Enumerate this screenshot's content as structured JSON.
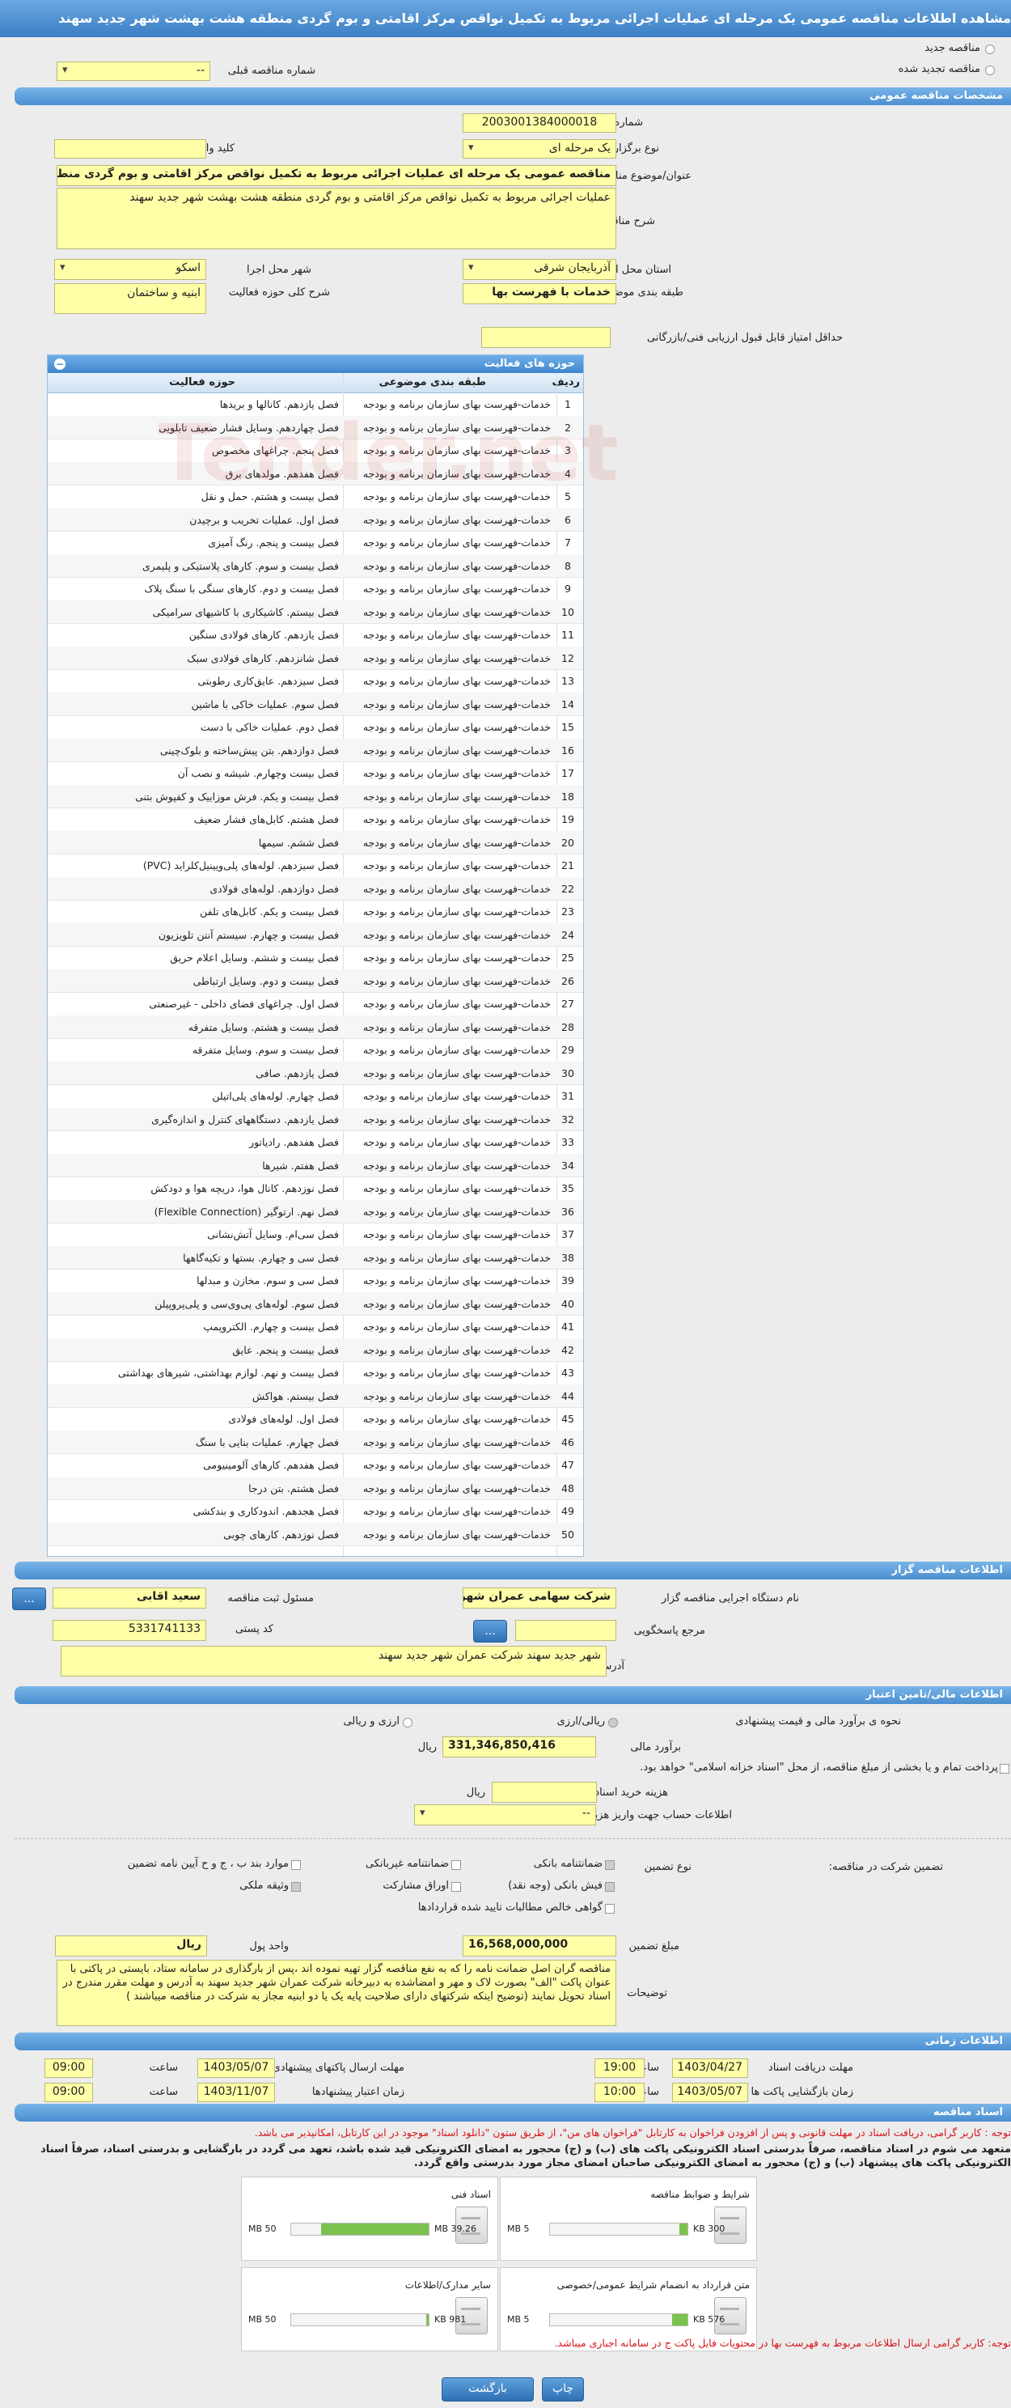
{
  "title": "مشاهده اطلاعات مناقصه عمومی یک مرحله ای عملیات اجرائی مربوط به تکمیل نواقص مرکز اقامتی و بوم گردی منطقه هشت بهشت شهر جدید سهند",
  "top": {
    "new_tender": "مناقصه جدید",
    "renewed_tender": "مناقصه تجدید شده",
    "prev_tender_label": "شماره مناقصه قبلی",
    "prev_tender_value": "--"
  },
  "sections": {
    "specs": "مشخصات مناقصه عمومی",
    "activity_grid": "حوزه های فعالیت",
    "organizer": "اطلاعات مناقصه گزار",
    "financial": "اطلاعات مالی/تامین اعتبار",
    "timing": "اطلاعات زمانی",
    "documents": "اسناد مناقصه"
  },
  "specs": {
    "number_label": "شماره مناقصه",
    "number": "2003001384000018",
    "type_label": "نوع برگزاری",
    "type": "یک مرحله ای",
    "keyword_label": "کلید واژه",
    "keyword": "",
    "subject_label": "عنوان/موضوع مناقصه",
    "subject": "مناقصه عمومی یک مرحله ای عملیات اجرائی مربوط به  تکمیل نواقص مرکز اقامتی و بوم گردی منطقه",
    "desc_label": "شرح مناقصه",
    "desc": "عملیات اجرائی مربوط به  تکمیل نواقص مرکز اقامتی و بوم گردی منطقه هشت بهشت شهر جدید سهند",
    "province_label": "استان محل اجرا",
    "province": "آذربایجان شرقی",
    "city_label": "شهر محل اجرا",
    "city": "اسکو",
    "category_label": "طبقه بندی موضوعی",
    "category": "خدمات با فهرست بها",
    "scope_label": "شرح کلی حوزه فعالیت",
    "scope": "ابنیه و ساختمان",
    "min_score_label": "حداقل امتیاز قابل قبول ارزیابی فنی/بازرگانی",
    "min_score": ""
  },
  "activity_grid": {
    "col_idx": "ردیف",
    "col_category": "طبقه بندی موضوعی",
    "col_activity": "حوزه فعالیت",
    "category_value": "خدمات-فهرست بهای سازمان برنامه و بودجه",
    "rows": [
      "فصل یازدهم. کانالها و بریدها",
      "فصل چهاردهم. وسایل فشار ضعیف تابلویی",
      "فصل پنجم. چراغهای مخصوص",
      "فصل هفدهم. مولدهای برق",
      "فصل بیست و هشتم. حمل و نقل",
      "فصل اول. عملیات تخریب و برچیدن",
      "فصل بیست و پنجم. رنگ آمیزی",
      "فصل بیست و سوم. کارهای پلاستیکی و پلیمری",
      "فصل بیست و دوم. کارهای سنگی با سنگ پلاک",
      "فصل بیستم. کاشیکاری با کاشیهای سرامیکی",
      "فصل یازدهم. کارهای فولادی سنگین",
      "فصل شانزدهم. کارهای فولادی سبک",
      "فصل سیزدهم. عایق‌کاری رطوبتی",
      "فصل سوم. عملیات خاکی با ماشین",
      "فصل دوم. عملیات خاکی با دست",
      "فصل دوازدهم. بتن پیش‌ساخته و بلوک‌چینی",
      "فصل بیست وچهارم. شیشه و نصب آن",
      "فصل بیست و یکم. فرش موزاییک و کفپوش بتنی",
      "فصل هشتم. کابل‌های فشار ضعیف",
      "فصل ششم. سیمها",
      "فصل سیزدهم. لوله‌های پلی‌ویینیل‌کلراید (PVC)",
      "فصل دوازدهم. لوله‌های فولادی",
      "فصل بیست و یکم. کابل‌های تلفن",
      "فصل بیست و چهارم. سیستم آنتن تلویزیون",
      "فصل بیست و ششم. وسایل اعلام حریق",
      "فصل بیست و دوم. وسایل ارتباطی",
      "فصل اول. چراغهای فضای داخلی - غیرصنعتی",
      "فصل بیست و هشتم. وسایل متفرقه",
      "فصل بیست و سوم. وسایل متفرقه",
      "فصل یازدهم. صافی",
      "فصل چهارم. لوله‌های پلی‌اتیلن",
      "فصل یازدهم. دستگاههای کنترل و اندازه‌گیری",
      "فصل هفدهم. رادیاتور",
      "فصل هفتم. شیرها",
      "فصل نوزدهم. کانال هوا، دریچه هوا و دودکش",
      "فصل نهم. ارتوگیر (Flexible Connection)",
      "فصل سی‌ام. وسایل آتش‌نشانی",
      "فصل سی و چهارم. بستها و تکیه‌گاهها",
      "فصل سی و سوم. مخازن و مبدلها",
      "فصل سوم. لوله‌های پی‌وی‌سی و پلی‌پروپیلن",
      "فصل بیست و چهارم. الکتروپمپ",
      "فصل بیست و پنجم. عایق",
      "فصل بیست و نهم. لوازم بهداشتی، شیرهای بهداشتی",
      "فصل بیستم. هواکش",
      "فصل اول. لوله‌های فولادی",
      "فصل چهارم. عملیات بنایی با سنگ",
      "فصل هفدهم. کارهای آلومینیومی",
      "فصل هشتم. بتن درجا",
      "فصل هجدهم. اندودکاری و بندکشی",
      "فصل نوزدهم. کارهای چوبی"
    ]
  },
  "organizer": {
    "org_label": "نام دستگاه اجرایی مناقصه گزار",
    "org": "شرکت سهامی عمران شهر",
    "responsible_label": "مسئول ثبت مناقصه",
    "responsible": "سعید اقابی",
    "ref_label": "مرجع پاسخگویی",
    "ref": "",
    "postal_label": "کد پستی",
    "postal": "5331741133",
    "address_label": "آدرس",
    "address": "شهر جدید سهند شرکت عمران شهر جدید سهند",
    "more_btn": "..."
  },
  "financial": {
    "estimate_type_label": "نحوه ی برآورد مالی و قیمت پیشنهادی",
    "rial_label": "ریالی/ارزی",
    "fx_rial_label": "ارزی و ریالی",
    "estimate_label": "برآورد مالی",
    "estimate": "331,346,850,416",
    "estimate_unit": "ریال",
    "partial_pay_text": "پرداخت تمام و یا بخشی از مبلغ مناقصه، از محل \"اسناد خزانه اسلامی\" خواهد بود.",
    "doc_fee_label": "هزینه خرید اسناد",
    "doc_fee": "",
    "doc_fee_unit": "ریال",
    "account_label": "اطلاعات حساب جهت واریز هزینه خرید اسناد",
    "account": "--",
    "participation_label": "تضمین شرکت در مناقصه:",
    "guarantee_type_label": "نوع تضمین",
    "options": [
      "ضمانتنامه بانکی",
      "ضمانتنامه غیربانکی",
      "موارد بند ب ، ج و ح آیین نامه تضمین",
      "فیش بانکی (وجه نقد)",
      "اوراق مشارکت",
      "وثیقه ملکی",
      "گواهی خالص مطالبات تایید شده قراردادها"
    ],
    "amount_label": "مبلغ تضمین",
    "amount": "16,568,000,000",
    "currency_label": "واحد پول",
    "currency": "ریال",
    "notes_label": "توضیحات",
    "notes": "مناقصه گران اصل ضمانت نامه را که به نفع مناقصه گزار تهیه نموده اند ،پس از بارگذاری در سامانه ستاد، بایستی در پاکتی با عنوان پاکت \"الف\" بصورت لاک و مهر و امضاشده به دبیرخانه شرکت عمران شهر جدید سهند به آدرس و مهلت مقرر مندرج در اسناد تحویل نمایند (توضیح اینکه شرکتهای دارای صلاحیت پایه یک یا دو ابنیه  مجاز به شرکت در مناقصه میباشند )"
  },
  "timing": {
    "doc_deadline_label": "مهلت دریافت اسناد",
    "doc_deadline_date": "1403/04/27",
    "doc_deadline_time": "19:00",
    "submit_label": "مهلت ارسال پاکتهای پیشنهادی",
    "submit_date": "1403/05/07",
    "submit_time": "09:00",
    "open_label": "زمان بازگشایی پاکت ها",
    "open_date": "1403/05/07",
    "open_time": "10:00",
    "validity_label": "زمان اعتبار پیشنهادها",
    "validity_date": "1403/11/07",
    "validity_time": "09:00",
    "time_label": "ساعت"
  },
  "documents": {
    "notice": "توجه : کاربر گرامی، دریافت اسناد در مهلت قانونی و پس از افزودن فراخوان به کارتابل \"فراخوان های من\"، از طریق ستون \"دانلود اسناد\" موجود در این کارتابل، امکانپذیر می باشد.",
    "pledge": "متعهد می شوم در اسناد مناقصه، صرفاً بدرستی اسناد الکترونیکی پاکت های (ب) و (ج) محجور به امضای الکترونیکی قید شده باشد، تعهد می گردد در بارگشایی و بدرستی اسناد، صرفاً اسناد الکترونیکی پاکت های پیشنهاد (ب) و (ج) محجور به امضای الکترونیکی صاحبان امضای مجاز مورد بدرستی واقع گردد.",
    "files": [
      {
        "name": "شرایط و ضوابط مناقصه",
        "size": "300 KB",
        "max": "5 MB",
        "fill": 0.06
      },
      {
        "name": "اسناد فنی",
        "size": "39.26 MB",
        "max": "50 MB",
        "fill": 0.78
      },
      {
        "name": "متن قرارداد به انضمام شرایط عمومی/خصوصی",
        "size": "576 KB",
        "max": "5 MB",
        "fill": 0.11
      },
      {
        "name": "سایر مدارک/اطلاعات",
        "size": "981 KB",
        "max": "50 MB",
        "fill": 0.02
      }
    ],
    "bottom_notice": "توجه: کاربر گرامی ارسال اطلاعات مربوط به فهرست بها در محتویات فایل پاکت ج در سامانه اجباری میباشد.",
    "print_btn": "چاپ",
    "back_btn": "بازگشت"
  },
  "watermark": "Tender.net"
}
